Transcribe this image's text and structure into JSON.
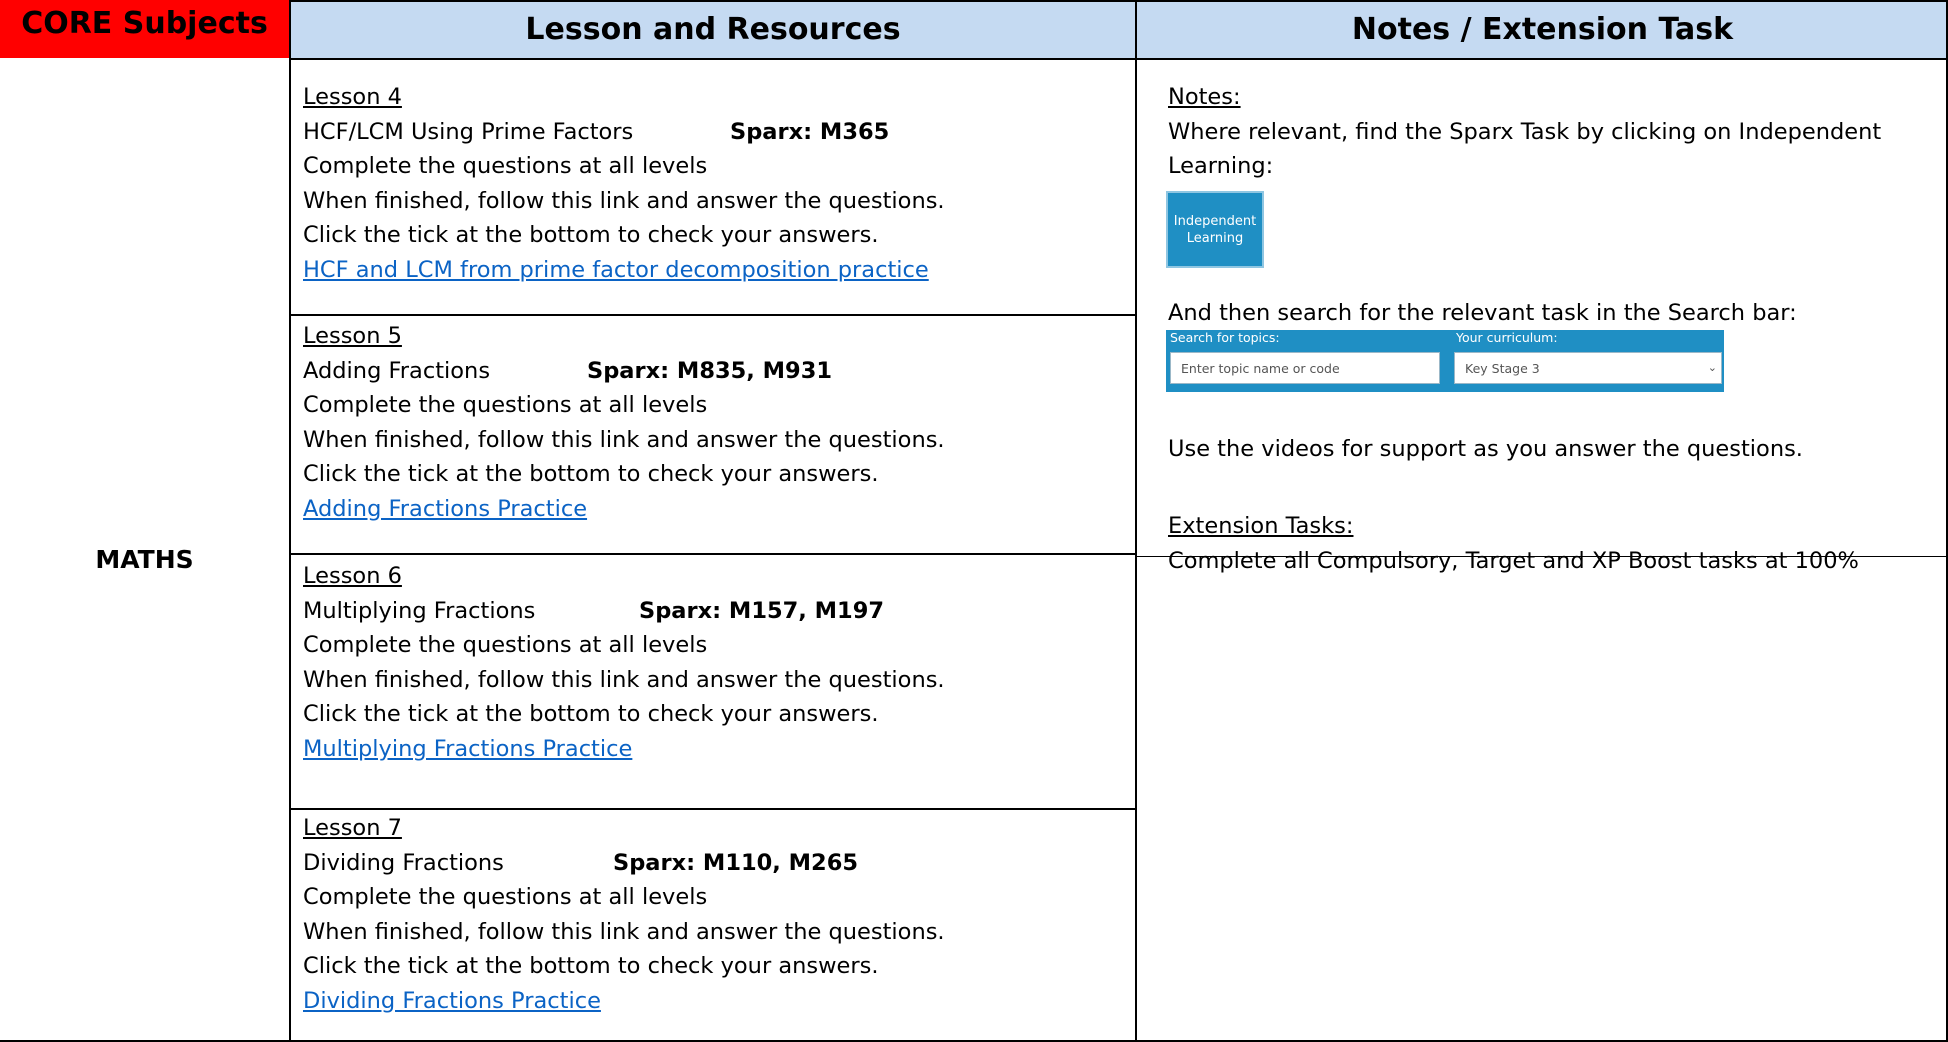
{
  "header": {
    "core": "CORE Subjects",
    "lesson": "Lesson and Resources",
    "notes": "Notes / Extension Task"
  },
  "subject": "MATHS",
  "lessons": [
    {
      "title": "Lesson 4",
      "topic": "HCF/LCM Using Prime Factors",
      "sparx": "Sparx: M365",
      "line1": "Complete the questions at all levels",
      "line2": "When finished, follow this link and answer the questions.",
      "line3": "Click the tick at the bottom to check your answers.",
      "link": "HCF and LCM from prime factor decomposition practice"
    },
    {
      "title": "Lesson 5",
      "topic": "Adding Fractions",
      "sparx": "Sparx: M835, M931",
      "line1": "Complete the questions at all levels",
      "line2": "When finished, follow this link and answer the questions.",
      "line3": "Click the tick at the bottom to check your answers.",
      "link": "Adding Fractions Practice"
    },
    {
      "title": "Lesson 6",
      "topic": "Multiplying Fractions",
      "sparx": "Sparx: M157, M197",
      "line1": "Complete the questions at all levels",
      "line2": "When finished, follow this link and answer the questions.",
      "line3": "Click the tick at the bottom to check your answers.",
      "link": "Multiplying Fractions Practice"
    },
    {
      "title": "Lesson 7",
      "topic": "Dividing Fractions",
      "sparx": "Sparx: M110, M265",
      "line1": "Complete the questions at all levels",
      "line2": "When finished, follow this link and answer the questions.",
      "line3": "Click the tick at the bottom to check your answers.",
      "link": "Dividing Fractions Practice"
    }
  ],
  "notes": {
    "heading": "Notes:",
    "line1": "Where relevant, find the Sparx Task by clicking on Independent",
    "line2": "Learning:",
    "button_line1": "Independent",
    "button_line2": "Learning",
    "search_intro": "And then search for the relevant task in the Search bar:",
    "search_topics_label": "Search for topics:",
    "search_placeholder": "Enter topic name or code",
    "curriculum_label": "Your curriculum:",
    "curriculum_value": "Key Stage 3",
    "videos": "Use the videos for support as you answer the questions.",
    "extension_heading": "Extension Tasks:",
    "extension_text": "Complete all Compulsory, Target and XP Boost tasks at 100%"
  },
  "colors": {
    "core_header_bg": "#ff0000",
    "header_bg": "#c5daf2",
    "link": "#0b63c5",
    "sparx_widget": "#1f8fc4"
  }
}
